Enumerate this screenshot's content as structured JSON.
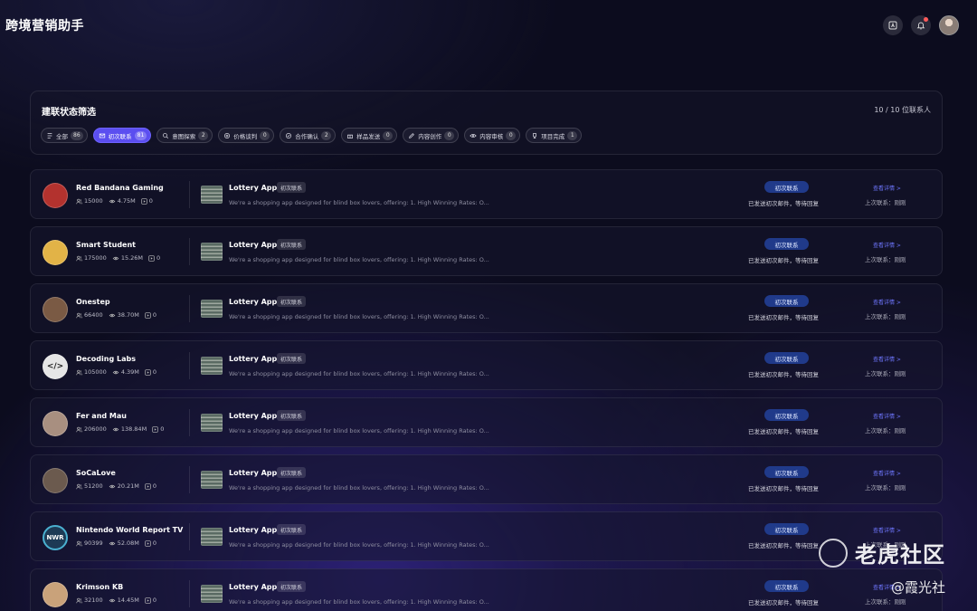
{
  "header": {
    "app_title": "跨境营销助手"
  },
  "filters": {
    "title": "建联状态筛选",
    "count_text": "10 / 10 位联系人",
    "chips": [
      {
        "label": "全部",
        "count": "86",
        "icon": "list-icon",
        "active": false
      },
      {
        "label": "初次联系",
        "count": "81",
        "icon": "mail-icon",
        "active": true
      },
      {
        "label": "意图探索",
        "count": "2",
        "icon": "search-icon",
        "active": false
      },
      {
        "label": "价格谈判",
        "count": "0",
        "icon": "coin-icon",
        "active": false
      },
      {
        "label": "合作确认",
        "count": "2",
        "icon": "check-circle-icon",
        "active": false
      },
      {
        "label": "样品发送",
        "count": "0",
        "icon": "gift-icon",
        "active": false
      },
      {
        "label": "内容创作",
        "count": "0",
        "icon": "pen-icon",
        "active": false
      },
      {
        "label": "内容审核",
        "count": "0",
        "icon": "eye-icon",
        "active": false
      },
      {
        "label": "项目完成",
        "count": "1",
        "icon": "trophy-icon",
        "active": false
      }
    ]
  },
  "contacts": [
    {
      "name": "Red Bandana Gaming",
      "followers": "15000",
      "views": "4.75M",
      "videos": "0",
      "app": "Lottery App",
      "tag": "初次联系",
      "desc": "We're a shopping app designed for blind box lovers, offering: 1. High Winning Rates: O...",
      "status": "初次联系",
      "status_text": "已发送初次邮件，等待回复",
      "detail": "查看详情 >",
      "last": "上次联系：刚刚"
    },
    {
      "name": "Smart Student",
      "followers": "175000",
      "views": "15.26M",
      "videos": "0",
      "app": "Lottery App",
      "tag": "初次联系",
      "desc": "We're a shopping app designed for blind box lovers, offering: 1. High Winning Rates: O...",
      "status": "初次联系",
      "status_text": "已发送初次邮件，等待回复",
      "detail": "查看详情 >",
      "last": "上次联系：刚刚"
    },
    {
      "name": "Onestep",
      "followers": "66400",
      "views": "38.70M",
      "videos": "0",
      "app": "Lottery App",
      "tag": "初次联系",
      "desc": "We're a shopping app designed for blind box lovers, offering: 1. High Winning Rates: O...",
      "status": "初次联系",
      "status_text": "已发送初次邮件，等待回复",
      "detail": "查看详情 >",
      "last": "上次联系：刚刚"
    },
    {
      "name": "Decoding Labs",
      "followers": "105000",
      "views": "4.39M",
      "videos": "0",
      "app": "Lottery App",
      "tag": "初次联系",
      "desc": "We're a shopping app designed for blind box lovers, offering: 1. High Winning Rates: O...",
      "status": "初次联系",
      "status_text": "已发送初次邮件，等待回复",
      "detail": "查看详情 >",
      "last": "上次联系：刚刚"
    },
    {
      "name": "Fer and Mau",
      "followers": "206000",
      "views": "138.84M",
      "videos": "0",
      "app": "Lottery App",
      "tag": "初次联系",
      "desc": "We're a shopping app designed for blind box lovers, offering: 1. High Winning Rates: O...",
      "status": "初次联系",
      "status_text": "已发送初次邮件，等待回复",
      "detail": "查看详情 >",
      "last": "上次联系：刚刚"
    },
    {
      "name": "SoCaLove",
      "followers": "51200",
      "views": "20.21M",
      "videos": "0",
      "app": "Lottery App",
      "tag": "初次联系",
      "desc": "We're a shopping app designed for blind box lovers, offering: 1. High Winning Rates: O...",
      "status": "初次联系",
      "status_text": "已发送初次邮件，等待回复",
      "detail": "查看详情 >",
      "last": "上次联系：刚刚"
    },
    {
      "name": "Nintendo World Report TV",
      "avatar_text": "NWR",
      "followers": "90399",
      "views": "52.08M",
      "videos": "0",
      "app": "Lottery App",
      "tag": "初次联系",
      "desc": "We're a shopping app designed for blind box lovers, offering: 1. High Winning Rates: O...",
      "status": "初次联系",
      "status_text": "已发送初次邮件，等待回复",
      "detail": "查看详情 >",
      "last": "上次联系：刚刚"
    },
    {
      "name": "Krimson KB",
      "followers": "32100",
      "views": "14.45M",
      "videos": "0",
      "app": "Lottery App",
      "tag": "初次联系",
      "desc": "We're a shopping app designed for blind box lovers, offering: 1. High Winning Rates: O...",
      "status": "初次联系",
      "status_text": "已发送初次邮件，等待回复",
      "detail": "查看详情 >",
      "last": "上次联系：刚刚"
    }
  ],
  "avatar_styles": [
    {
      "bg": "#b3322e",
      "fg": "#ffffff"
    },
    {
      "bg": "#e2b347",
      "fg": "#ffffff"
    },
    {
      "bg": "#7a5a44",
      "fg": "#ffffff"
    },
    {
      "bg": "#e6e6e6",
      "fg": "#222222"
    },
    {
      "bg": "#a88f80",
      "fg": "#ffffff"
    },
    {
      "bg": "#6b5a4e",
      "fg": "#ffffff"
    },
    {
      "bg": "#1d3a55",
      "fg": "#ffffff"
    },
    {
      "bg": "#c9a27a",
      "fg": "#ffffff"
    }
  ],
  "decoding_labs_symbol": "</>",
  "watermark": {
    "main": "老虎社区",
    "sub": "@霞光社"
  }
}
